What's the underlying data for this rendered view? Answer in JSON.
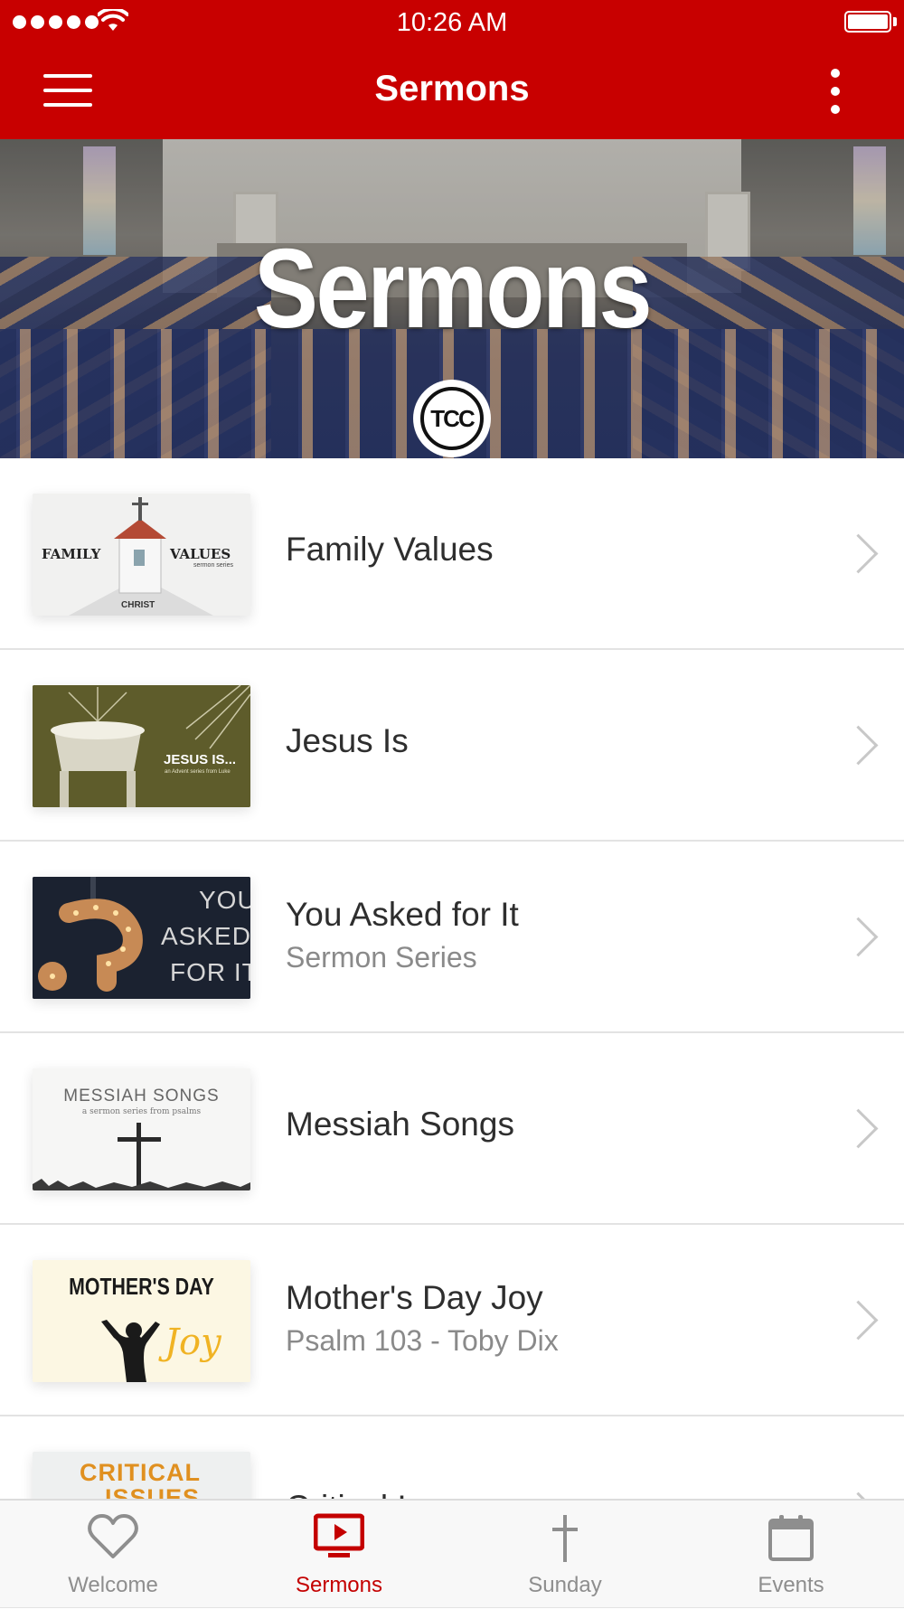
{
  "status_bar": {
    "time": "10:26 AM"
  },
  "nav": {
    "title": "Sermons",
    "menu_icon": "hamburger-menu-icon",
    "more_icon": "vertical-ellipsis-icon"
  },
  "hero": {
    "title": "Sermons",
    "logo_text": "TCC"
  },
  "sermons": [
    {
      "title": "Family Values",
      "subtitle": "",
      "thumb_text": [
        "FAMILY",
        "VALUES",
        "sermon series",
        "CHRIST"
      ]
    },
    {
      "title": "Jesus Is",
      "subtitle": "",
      "thumb_text": [
        "JESUS IS...",
        "an Advent series from Luke"
      ]
    },
    {
      "title": "You Asked for It",
      "subtitle": "Sermon Series",
      "thumb_text": [
        "YOU",
        "ASKED",
        "FOR IT"
      ]
    },
    {
      "title": "Messiah Songs",
      "subtitle": "",
      "thumb_text": [
        "MESSIAH SONGS",
        "a sermon series from psalms"
      ]
    },
    {
      "title": "Mother's Day Joy",
      "subtitle": "Psalm 103 - Toby Dix",
      "thumb_text": [
        "MOTHER'S DAY",
        "Joy"
      ]
    },
    {
      "title": "Critical Issues",
      "subtitle": "",
      "thumb_text": [
        "CRITICAL",
        "ISSUES"
      ]
    }
  ],
  "tabs": [
    {
      "label": "Welcome",
      "icon": "heart-icon",
      "active": false
    },
    {
      "label": "Sermons",
      "icon": "tv-play-icon",
      "active": true
    },
    {
      "label": "Sunday",
      "icon": "cross-icon",
      "active": false
    },
    {
      "label": "Events",
      "icon": "calendar-icon",
      "active": false
    }
  ],
  "colors": {
    "brand": "#c80000",
    "active_tab": "#c40000",
    "inactive_tab": "#8e8e8e"
  }
}
